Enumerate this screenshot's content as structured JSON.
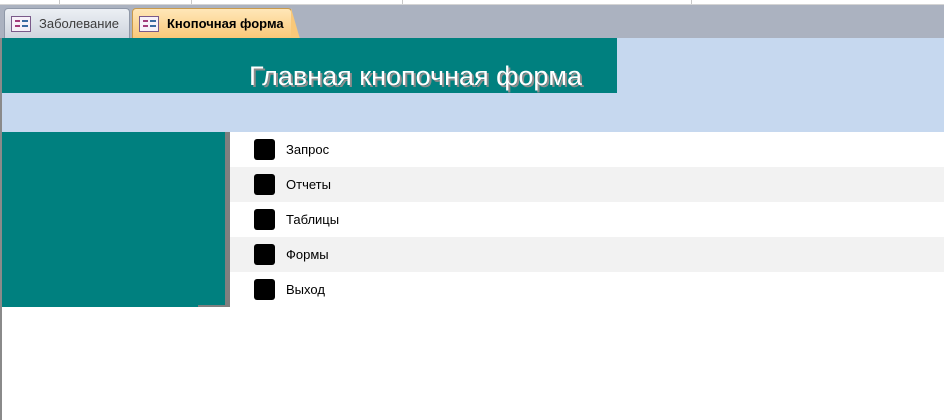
{
  "tabs": [
    {
      "label": "Заболевание",
      "active": false
    },
    {
      "label": "Кнопочная форма",
      "active": true
    }
  ],
  "form": {
    "title": "Главная кнопочная форма",
    "items": [
      {
        "label": "Запрос"
      },
      {
        "label": "Отчеты"
      },
      {
        "label": "Таблицы"
      },
      {
        "label": "Формы"
      },
      {
        "label": "Выход"
      }
    ]
  },
  "colors": {
    "header_teal": "#00807f",
    "header_light": "#c6d8ef",
    "active_tab": "#f9c879",
    "tab_bar": "#abb2c0"
  }
}
